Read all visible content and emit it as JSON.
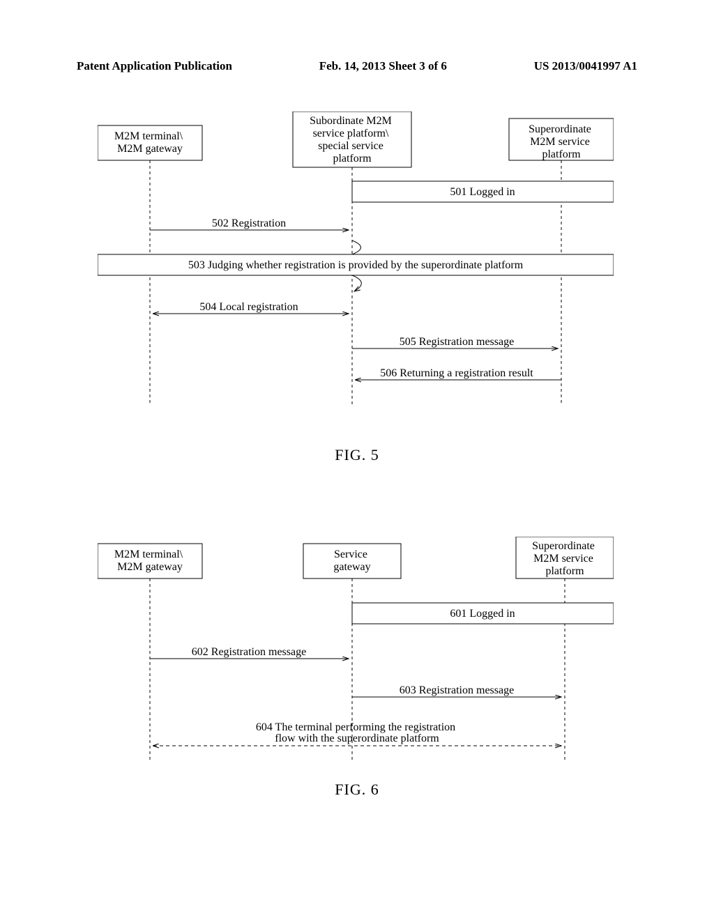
{
  "header": {
    "left": "Patent Application Publication",
    "center": "Feb. 14, 2013  Sheet 3 of 6",
    "right": "US 2013/0041997 A1"
  },
  "fig5": {
    "actors": {
      "a1": "M2M terminal\\\nM2M gateway",
      "a2": "Subordinate M2M\nservice platform\\\nspecial service\nplatform",
      "a3": "Superordinate\nM2M service\nplatform"
    },
    "messages": {
      "m501": "501 Logged in",
      "m502": "502 Registration",
      "m503": "503 Judging whether registration is provided by the superordinate platform",
      "m504": "504 Local registration",
      "m505": "505 Registration message",
      "m506": "506 Returning a registration result"
    },
    "caption": "FIG. 5"
  },
  "fig6": {
    "actors": {
      "a1": "M2M terminal\\\nM2M gateway",
      "a2": "Service\ngateway",
      "a3": "Superordinate\nM2M service\nplatform"
    },
    "messages": {
      "m601": "601  Logged in",
      "m602": "602  Registration message",
      "m603": "603  Registration message",
      "m604": "604  The terminal performing the registration\nflow with the superordinate platform"
    },
    "caption": "FIG. 6"
  }
}
